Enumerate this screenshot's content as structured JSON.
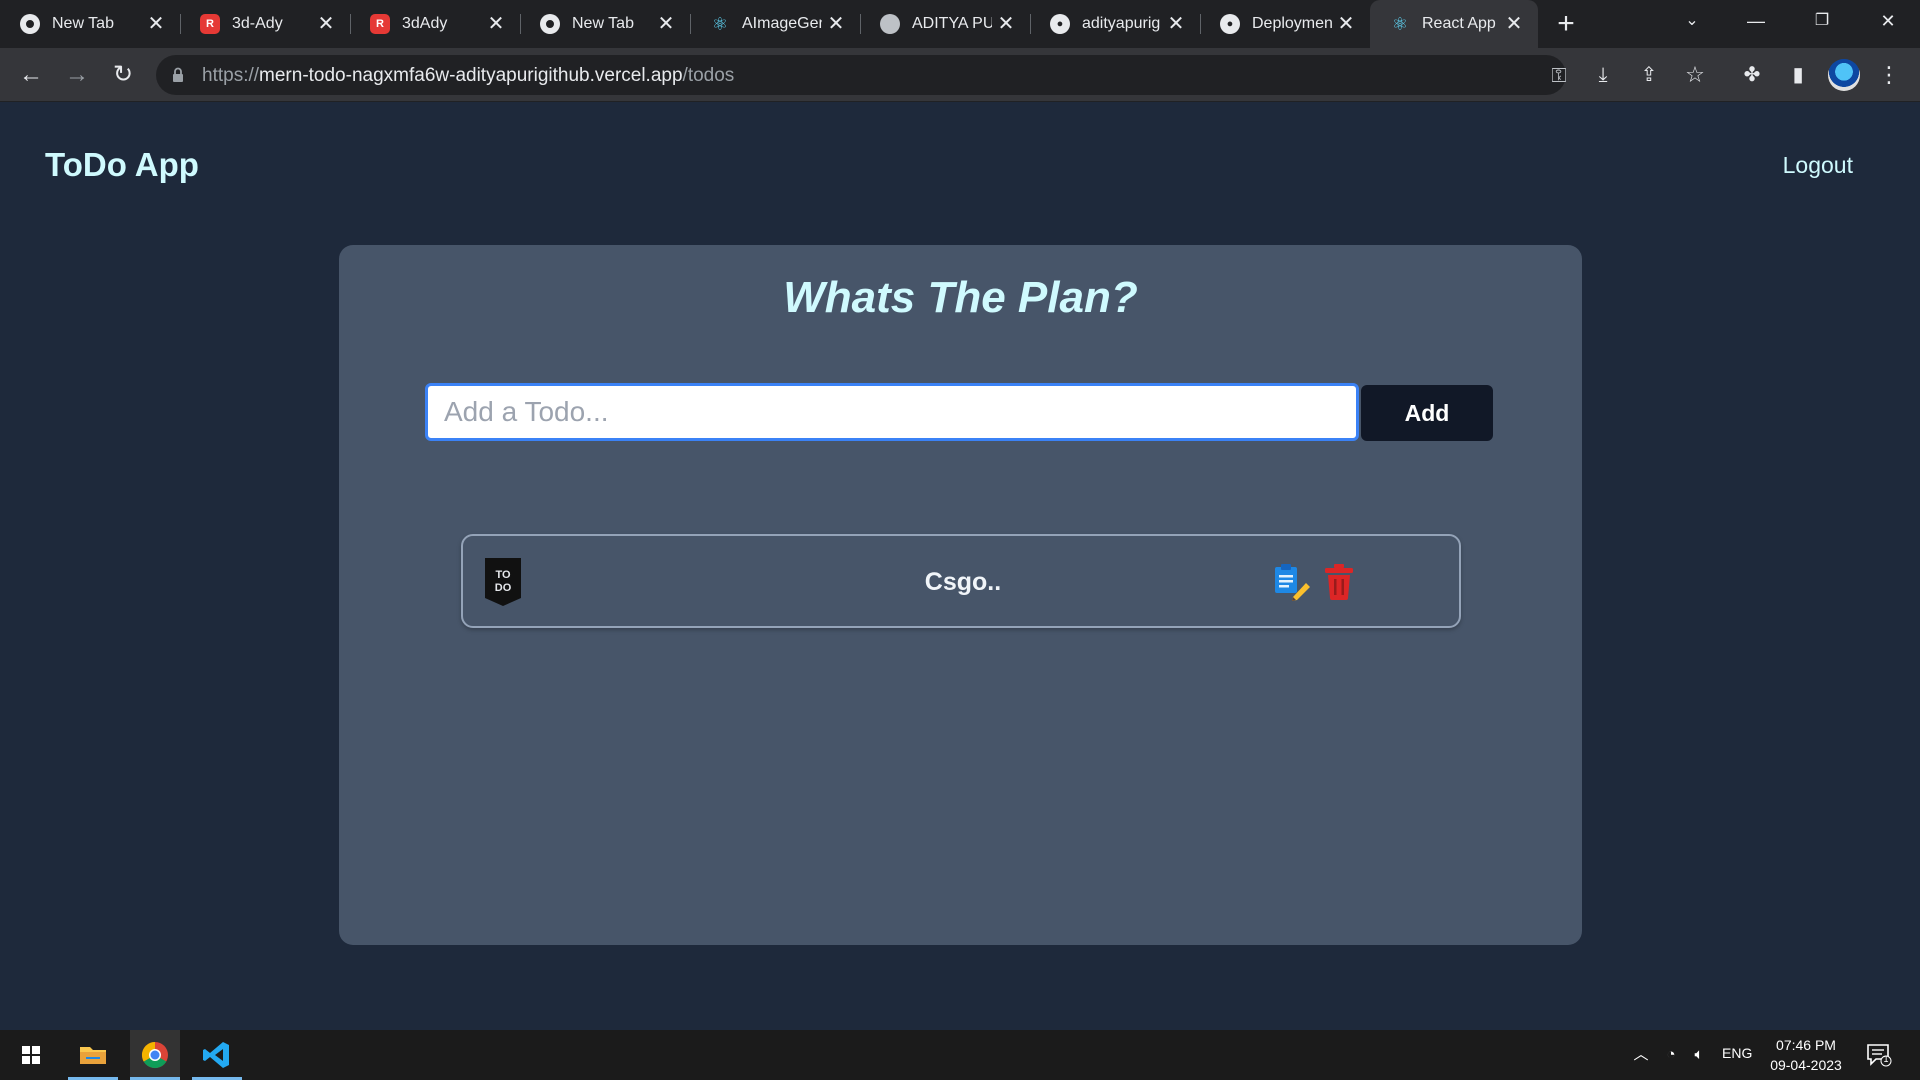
{
  "browser": {
    "tabs": [
      {
        "title": "New Tab",
        "icon": "chrome-icon"
      },
      {
        "title": "3d-Ady",
        "icon": "app-icon"
      },
      {
        "title": "3dAdy",
        "icon": "app-icon"
      },
      {
        "title": "New Tab",
        "icon": "chrome-icon"
      },
      {
        "title": "AImageGen",
        "icon": "react-icon"
      },
      {
        "title": "ADITYA PURI",
        "icon": "globe-icon"
      },
      {
        "title": "adityapurig",
        "icon": "github-icon"
      },
      {
        "title": "Deployments",
        "icon": "github-icon"
      },
      {
        "title": "React App",
        "icon": "react-icon",
        "active": true
      }
    ],
    "url_scheme": "https://",
    "url_host": "mern-todo-nagxmfa6w-adityapurigithub.vercel.app",
    "url_path": "/todos"
  },
  "app": {
    "brand": "ToDo App",
    "logout_label": "Logout",
    "heading": "Whats The Plan?",
    "input_placeholder": "Add a Todo...",
    "input_value": "",
    "add_label": "Add",
    "todos": [
      {
        "text": "Csgo..",
        "logo_text": "TO DO"
      }
    ]
  },
  "taskbar": {
    "language": "ENG",
    "time": "07:46 PM",
    "date": "09-04-2023",
    "notification_count": "1"
  },
  "colors": {
    "page_bg": "#1e293b",
    "card_bg": "#475569",
    "accent_text": "#cffafe",
    "button_bg": "#111827",
    "delete_red": "#dc2626",
    "edit_blue": "#2563eb"
  }
}
